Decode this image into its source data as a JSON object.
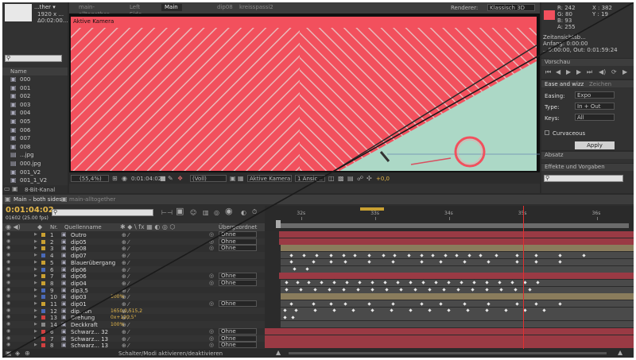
{
  "project": {
    "comp_name": "...ther ▾",
    "comp_size": "1920 x ...",
    "comp_duration": "Δ0:02:00...",
    "search_placeholder": "",
    "column_name": "Name",
    "items": [
      {
        "name": "000",
        "type": "comp"
      },
      {
        "name": "001",
        "type": "comp"
      },
      {
        "name": "002",
        "type": "comp"
      },
      {
        "name": "003",
        "type": "comp"
      },
      {
        "name": "004",
        "type": "comp"
      },
      {
        "name": "005",
        "type": "comp"
      },
      {
        "name": "006",
        "type": "comp"
      },
      {
        "name": "007",
        "type": "comp"
      },
      {
        "name": "008",
        "type": "comp"
      },
      {
        "name": "...jpg",
        "type": "image"
      },
      {
        "name": "000.jpg",
        "type": "image"
      },
      {
        "name": "001_V2",
        "type": "comp"
      },
      {
        "name": "001_1_V2",
        "type": "comp"
      }
    ],
    "bpc": "8-Bit-Kanal"
  },
  "viewer": {
    "tabs": [
      "main-alltogether",
      "Left Side",
      "Main – both sides",
      "dip08",
      "kreisspassi2"
    ],
    "active_tab": 2,
    "renderer_label": "Renderer:",
    "renderer_value": "Klassisch 3D",
    "camera_label": "Aktive Kamera",
    "zoom": "(55,4%)",
    "timecode": "0:01:04:02",
    "resolution": "(Voll)",
    "view": "Aktive Kamera",
    "views": "1 Ansic...",
    "exposure": "+0,0"
  },
  "info": {
    "r": "R:  242",
    "g": "G:  80",
    "b": "B:  93",
    "a": "A:  255",
    "x": "X : 382",
    "y": "Y : 19",
    "color": "#f2505d",
    "time_lines": [
      "Zeitansichtsb...",
      "Anfang: 0:00:00",
      "...0:00:00, Out: 0:01:59:24"
    ]
  },
  "preview": {
    "title": "Vorschau"
  },
  "ease": {
    "tabs": [
      "Ease and wizz",
      "Zeichen"
    ],
    "easing_label": "Easing:",
    "easing_value": "Expo",
    "type_label": "Type:",
    "type_value": "In + Out",
    "keys_label": "Keys:",
    "keys_value": "All",
    "curvaceous": "Curvaceous",
    "apply": "Apply"
  },
  "paragraph": {
    "title": "Absatz"
  },
  "effects": {
    "title": "Effekte und Vorgaben",
    "search_placeholder": ""
  },
  "timeline": {
    "tabs": [
      "Main – both sides",
      "main-alltogether"
    ],
    "timecode": "0:01:04:02",
    "frames": "01602 (25.00 fps)",
    "col_nr": "Nr.",
    "col_source": "Quellenname",
    "col_parent": "Übergeordnet",
    "ruler": [
      "32s",
      "33s",
      "34s",
      "35s",
      "36s"
    ],
    "playhead_sec": 35.0,
    "footer": "Schalter/Modi aktivieren/deaktivieren",
    "layers": [
      {
        "nr": "1",
        "name": "Outro",
        "parent": "Ohne"
      },
      {
        "nr": "2",
        "name": "dip05",
        "parent": "Ohne"
      },
      {
        "nr": "3",
        "name": "dip08",
        "parent": "Ohne"
      },
      {
        "nr": "4",
        "name": "dip07",
        "parent": ""
      },
      {
        "nr": "5",
        "name": "Blauerübergang",
        "parent": ""
      },
      {
        "nr": "6",
        "name": "dip06",
        "parent": ""
      },
      {
        "nr": "7",
        "name": "dip06",
        "parent": "Ohne"
      },
      {
        "nr": "8",
        "name": "dip04",
        "parent": "Ohne"
      },
      {
        "nr": "9",
        "name": "dip3,5",
        "parent": ""
      },
      {
        "nr": "10",
        "name": "dip03",
        "parent": ""
      },
      {
        "nr": "11",
        "name": "dip01",
        "parent": "Ohne"
      },
      {
        "nr": "12",
        "name": "dip...on",
        "parent": ""
      },
      {
        "nr": "13",
        "name": "Drehung",
        "parent": ""
      },
      {
        "nr": "14",
        "name": "Deckkraft",
        "parent": ""
      },
      {
        "nr": "6",
        "name": "Schwarz... 32",
        "parent": "Ohne"
      },
      {
        "nr": "7",
        "name": "Schwarz... 13",
        "parent": "Ohne"
      },
      {
        "nr": "8",
        "name": "Schwarz... 13",
        "parent": "Ohne"
      }
    ],
    "values": {
      "position": "1650,0,515,2",
      "rotation": "0x+120,5°",
      "opacity": "100%",
      "v1": "100%"
    },
    "colors": {
      "track_red": "#9a3a44",
      "track_tan": "#8a7c5c",
      "track_gray": "#4a4a4a",
      "playhead": "#e03030"
    }
  }
}
